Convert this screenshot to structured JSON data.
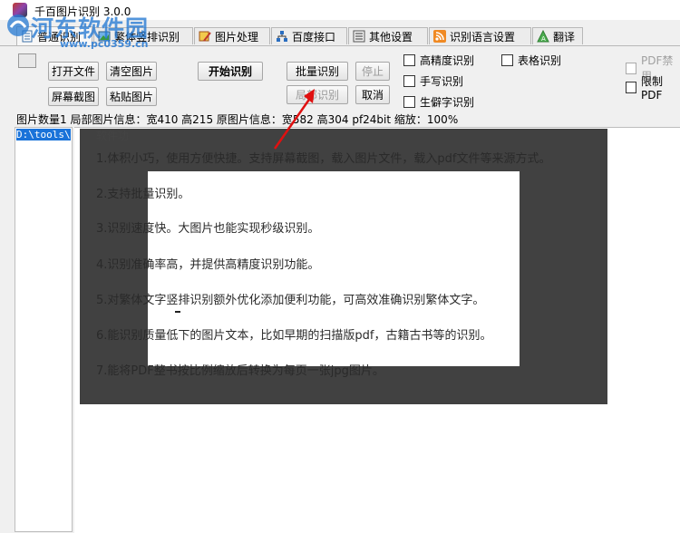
{
  "window": {
    "title": "千百图片识别 3.0.0"
  },
  "watermark": {
    "text": "河东软件园",
    "url": "www.pc0359.cn"
  },
  "tabs": [
    {
      "label": "普通识别",
      "icon": "document-icon"
    },
    {
      "label": "繁体竖排识别",
      "icon": "image-icon"
    },
    {
      "label": "图片处理",
      "icon": "edit-image-icon"
    },
    {
      "label": "百度接口",
      "icon": "network-icon"
    },
    {
      "label": "其他设置",
      "icon": "settings-list-icon"
    },
    {
      "label": "识别语言设置",
      "icon": "rss-icon"
    },
    {
      "label": "翻译",
      "icon": "translate-icon"
    }
  ],
  "buttons": {
    "open_file": "打开文件",
    "clear_image": "清空图片",
    "start_recognition": "开始识别",
    "batch_recognition": "批量识别",
    "stop": "停止",
    "screenshot": "屏幕截图",
    "paste_image": "粘贴图片",
    "partial_recognition": "局部识别",
    "cancel": "取消"
  },
  "options": {
    "high_precision": "高精度识别",
    "table": "表格识别",
    "handwriting": "手写识别",
    "rare_chars": "生僻字识别",
    "pdf_disable": "PDF禁用",
    "limit_pdf": "限制PDF"
  },
  "status": "图片数量1 局部图片信息：宽410 高215 原图片信息：宽582 高304 pf24bit 缩放：100%",
  "file_list": [
    "D:\\tools\\"
  ],
  "image_text": {
    "title_fragment": "软件功",
    "lines": [
      "1.体积小巧，使用方便快捷。支持屏幕截图，载入图片文件，载入pdf文件等来源方式。",
      "2.支持批量识别。",
      "3.识别速度快。大图片也能实现秒级识别。",
      "4.识别准确率高，并提供高精度识别功能。",
      "5.对繁体文字竖排识别额外优化添加便利功能，可高效准确识别繁体文字。",
      "6.能识别质量低下的图片文本，比如早期的扫描版pdf，古籍古书等的识别。",
      "7.能将PDF整书按比例缩放后转换为每页一张jpg图片。"
    ]
  }
}
